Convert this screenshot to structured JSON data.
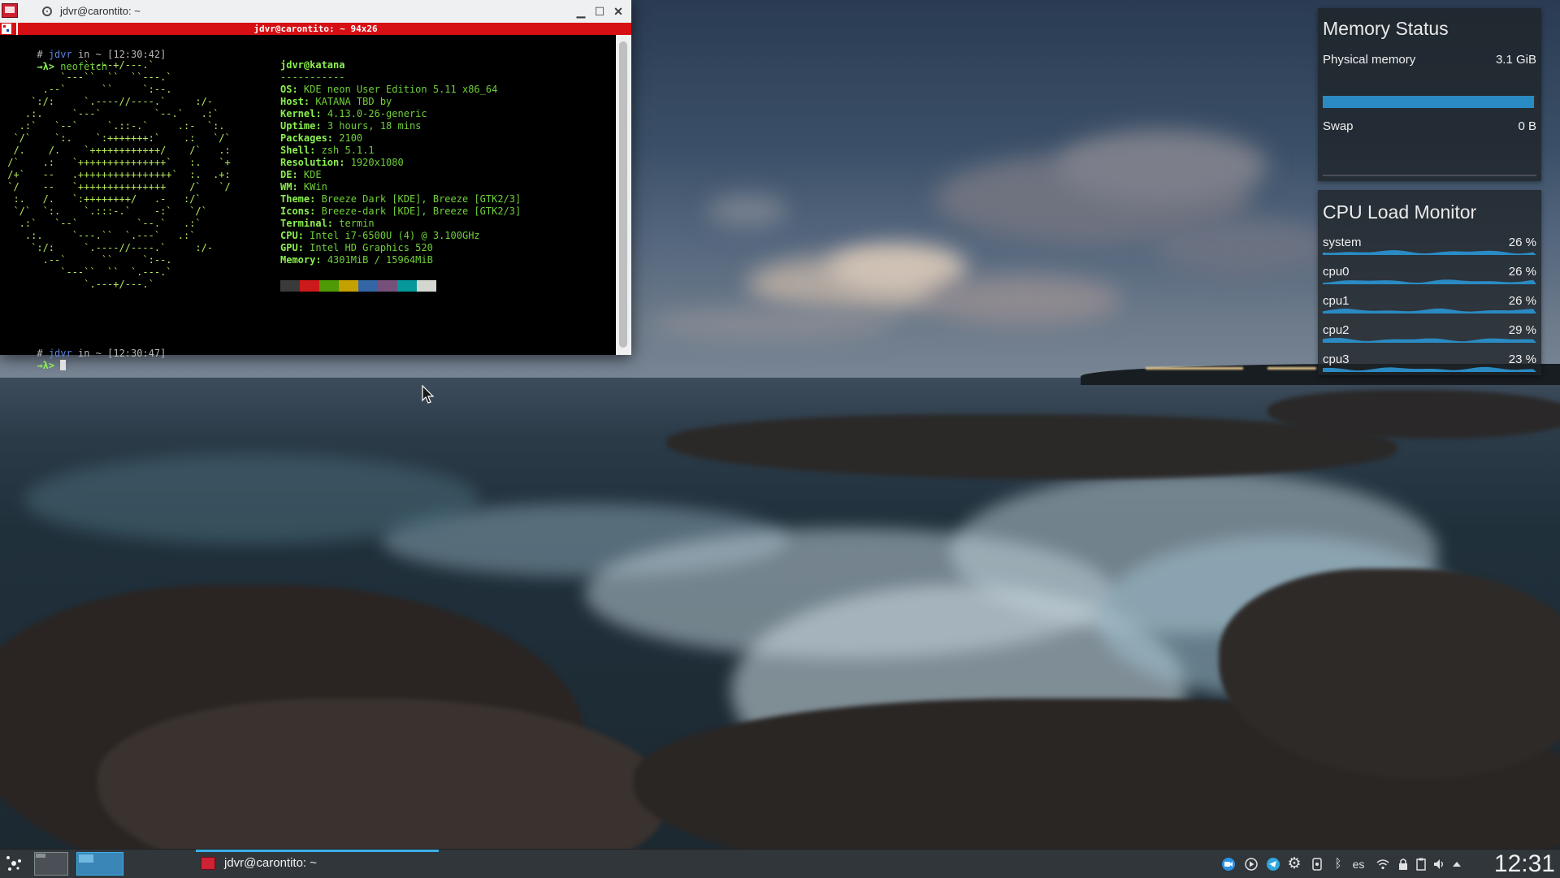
{
  "terminal": {
    "window_title": "jdvr@carontito: ~",
    "tab_title": "jdvr@carontito: ~ 94x26",
    "prompt1": {
      "hash": "#",
      "user": "jdvr",
      "in": "in",
      "dir": "~",
      "time": "[12:30:42]"
    },
    "arrow1": "→λ>",
    "command": "neofetch",
    "ascii_art": [
      "              `.---+/---.`",
      "          `---``  ``  ``---.`",
      "       .--`      ``     `:--.",
      "     `:/:     `.----//----.`     :/-",
      "    .:.     `---`         `--.`   .:`",
      "   .:`   `--`     `.::-.`     .:-  `:.",
      "  `/`    `:.    `:+++++++:`    .:   `/`",
      "  /.    /.    `++++++++++++/    /`   .:",
      " /`    .:   `+++++++++++++++`   :.   `+",
      " /+`   --   .++++++++++++++++`  :.  .+:",
      " `/    --   `+++++++++++++++    /`   `/",
      "  :.   /.   `:++++++++/   .-   :/`",
      "  `/`  `:.    `.:::-.`    -:`   `/`",
      "   .:`   `--`          `--.`   .:`",
      "    .:.     `---.``  `.---`   .:`",
      "     `:/:     `.----//----.`     :/-",
      "       .--`      ``     `:--.",
      "          `---``  ``  `.---.`",
      "              `.---+/---.`"
    ],
    "user_host": "jdvr@katana",
    "separator": "-----------",
    "info": [
      {
        "key": "OS",
        "value": "KDE neon User Edition 5.11 x86_64"
      },
      {
        "key": "Host",
        "value": "KATANA TBD by"
      },
      {
        "key": "Kernel",
        "value": "4.13.0-26-generic"
      },
      {
        "key": "Uptime",
        "value": "3 hours, 18 mins"
      },
      {
        "key": "Packages",
        "value": "2100"
      },
      {
        "key": "Shell",
        "value": "zsh 5.1.1"
      },
      {
        "key": "Resolution",
        "value": "1920x1080"
      },
      {
        "key": "DE",
        "value": "KDE"
      },
      {
        "key": "WM",
        "value": "KWin"
      },
      {
        "key": "Theme",
        "value": "Breeze Dark [KDE], Breeze [GTK2/3]"
      },
      {
        "key": "Icons",
        "value": "Breeze-dark [KDE], Breeze [GTK2/3]"
      },
      {
        "key": "Terminal",
        "value": "termin"
      },
      {
        "key": "CPU",
        "value": "Intel i7-6500U (4) @ 3.100GHz"
      },
      {
        "key": "GPU",
        "value": "Intel HD Graphics 520"
      },
      {
        "key": "Memory",
        "value": "4301MiB / 15964MiB"
      }
    ],
    "color_swatches": [
      "#3a3a3a",
      "#cc1a1a",
      "#4e9a06",
      "#c4a000",
      "#3465a4",
      "#75507b",
      "#06989a",
      "#d3d7cf"
    ],
    "prompt2": {
      "hash": "#",
      "user": "jdvr",
      "in": "in",
      "dir": "~",
      "time": "[12:30:47]"
    },
    "arrow2": "→λ>"
  },
  "memory_widget": {
    "title": "Memory Status",
    "physical_label": "Physical memory",
    "physical_value": "3.1 GiB",
    "physical_fraction": 0.99,
    "swap_label": "Swap",
    "swap_value": "0 B"
  },
  "cpu_widget": {
    "title": "CPU Load Monitor",
    "rows": [
      {
        "name": "system",
        "value": "26 %"
      },
      {
        "name": "cpu0",
        "value": "26 %"
      },
      {
        "name": "cpu1",
        "value": "26 %"
      },
      {
        "name": "cpu2",
        "value": "29 %"
      },
      {
        "name": "cpu3",
        "value": "23 %"
      }
    ]
  },
  "taskbar": {
    "task_label": "jdvr@carontito: ~",
    "keyboard_layout": "es",
    "clock": "12:31"
  },
  "colors": {
    "accent": "#3daee9",
    "terminal_tab": "#d60f14",
    "terminal_green": "#8bf051",
    "panel": "#31363b"
  }
}
